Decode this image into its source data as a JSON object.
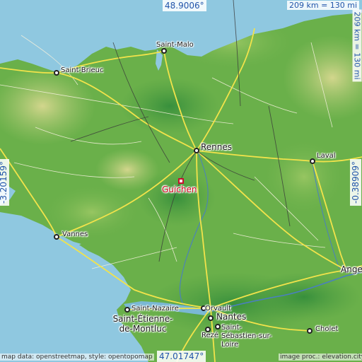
{
  "map": {
    "place": "Guichen",
    "coordinates": {
      "north": "48.9006°",
      "south": "47.01747°",
      "west": "-3.20159°",
      "east": "-0.38909°"
    },
    "scale_horizontal": "209 km = 130 mi",
    "scale_vertical": "209 km = 130 mi",
    "cities": [
      {
        "name": "Saint-Malo"
      },
      {
        "name": "Saint-Brieuc"
      },
      {
        "name": "Rennes"
      },
      {
        "name": "Laval"
      },
      {
        "name": "Vannes"
      },
      {
        "name": "Angers"
      },
      {
        "name": "Saint-Nazaire"
      },
      {
        "name": "Saint-Étienne-de-Montluc"
      },
      {
        "name": "Orvault"
      },
      {
        "name": "Nantes"
      },
      {
        "name": "Saint-Sébastien-sur-Loire"
      },
      {
        "name": "Rezé"
      },
      {
        "name": "Cholet"
      }
    ],
    "credit_left": "map data: openstreetmap, style: opentopomap",
    "credit_right": "image proc.: elevation.city"
  },
  "colors": {
    "sea": "#8fc8e0",
    "land": "#6ab04a",
    "highland": "#c8c878",
    "road_major": "#f2e34b",
    "target": "#d0021b",
    "coord_text": "#2255aa"
  }
}
